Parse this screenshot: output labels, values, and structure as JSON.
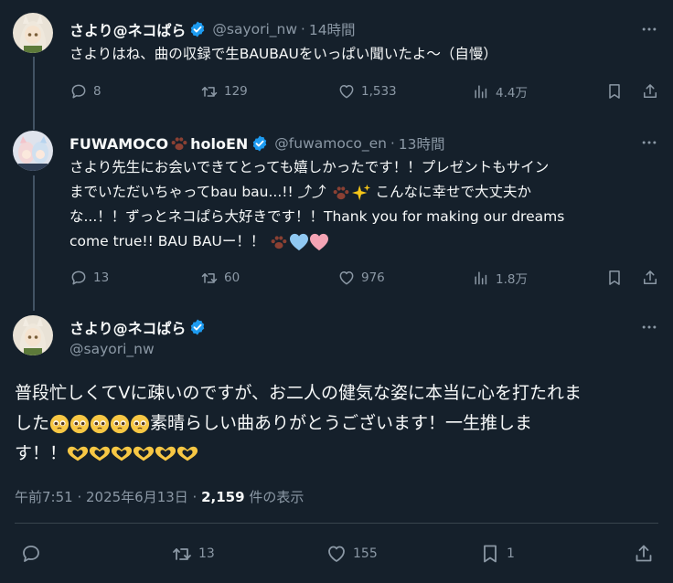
{
  "tweet1": {
    "name": "さより@ネコぱら",
    "handle": "@sayori_nw",
    "time": "14時間",
    "text": "さよりはね、曲の収録で生BAUBAUをいっぱい聞いたよ～（自慢）",
    "replies": "8",
    "retweets": "129",
    "likes": "1,533",
    "views": "4.4万"
  },
  "tweet2": {
    "name": "FUWAMOCO",
    "name_suffix": "holoEN",
    "handle": "@fuwamoco_en",
    "time": "13時間",
    "text_line1": "さより先生にお会いできてとっても嬉しかったです！！プレゼントもサイン",
    "text_line2": "までいただいちゃってbau bau...!! ⤴⤴",
    "text_line2b": "こんなに幸せで大丈夫か",
    "text_line3": "な...！！ずっとネコぱら大好きです！！Thank you for making our dreams",
    "text_line4": "come true!! BAU BAUー！！",
    "replies": "13",
    "retweets": "60",
    "likes": "976",
    "views": "1.8万"
  },
  "tweet3": {
    "name": "さより@ネコぱら",
    "handle": "@sayori_nw",
    "text_line1": "普段忙しくてVに疎いのですが、お二人の健気な姿に本当に心を打たれま",
    "text_line2a": "した",
    "text_line2b": "素晴らしい曲ありがとうございます！一生推しま",
    "text_line3": "す！！",
    "timestamp": "午前7:51 · 2025年6月13日 · ",
    "views_count": "2,159",
    "views_label": " 件の表示",
    "replies": "",
    "retweets": "13",
    "likes": "155",
    "bookmarks": "1"
  },
  "colors": {
    "background": "#15202b",
    "text": "#f7f9f9",
    "muted": "#8b98a5",
    "verified": "#1d9bf0",
    "thread_line": "#425364"
  },
  "icons": [
    "reply-icon",
    "retweet-icon",
    "like-icon",
    "views-icon",
    "bookmark-icon",
    "share-icon",
    "more-icon",
    "verified-icon"
  ]
}
